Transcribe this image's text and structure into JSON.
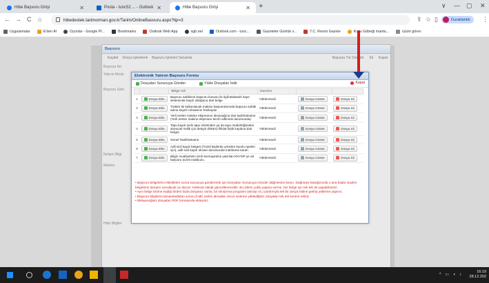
{
  "browser": {
    "tabs": [
      {
        "title": "Hibe Başvuru Girişi",
        "color": "#1a73e8"
      },
      {
        "title": "Posta - tunc52 ... - Outlook",
        "color": "#0a64c2"
      },
      {
        "title": "Hibe Başvuru Girişi",
        "color": "#1a73e8"
      }
    ],
    "new_tab": "+",
    "win_controls": [
      "∨",
      "—",
      "▢",
      "✕"
    ],
    "url": "hibedestek.tarimorman.gov.tr/Tarim/OnlineBasvuru.aspx?tip=3",
    "nav": [
      "←",
      "→",
      "C",
      "⌂"
    ],
    "profile_label": "Duraklatıldı",
    "bookmarks": [
      {
        "label": "Uygulamalar",
        "color": "#5f6368"
      },
      {
        "label": "E'den Al",
        "color": "#e8a317"
      },
      {
        "label": "Oyunlar - Google Pl...",
        "color": "#444"
      },
      {
        "label": "Bookmarks",
        "color": "#333"
      },
      {
        "label": "Outlook Web App",
        "color": "#c0392b"
      },
      {
        "label": "sgb.net",
        "color": "#333"
      },
      {
        "label": "Outlook.com - tunc...",
        "color": "#0a64c2"
      },
      {
        "label": "Gazeteler Günlük v...",
        "color": "#555"
      },
      {
        "label": "T.C. Resmi Gazete",
        "color": "#c0392b"
      },
      {
        "label": "Kuzu Göbeği mantа...",
        "color": "#e8a317"
      },
      {
        "label": "üzüm görev",
        "color": "#8a8a8a"
      }
    ]
  },
  "outer_window": {
    "title": "Başvuru",
    "toolbar_left": [
      "Kaydet",
      "Dosya İşlemleri▾",
      "Başvuru İşlemini Tamamla"
    ],
    "toolbar_right": [
      "Başvuru Tür Değiştir",
      "Sil",
      "Kapat"
    ],
    "side_labels": [
      "Başvuru No",
      "Yatırım Modu",
      "Başvuru Sahi",
      "İletişim Bilgi",
      "Makine",
      "Hibe Bilgiler"
    ]
  },
  "dialog": {
    "title": "Elektronik Yatırım Başvuru Formu",
    "send_button": "Dosyaları Sunucuya Gönder",
    "download_button": "Yükle Dosyaları İndir",
    "close_label": "Kapat",
    "headers": [
      "",
      "",
      "Belge Adı",
      "Durumu",
      "",
      ""
    ],
    "add_label": "Dosya Ekle",
    "view_label": "Dosya Göster",
    "delete_label": "Dosya Sil",
    "rows": [
      {
        "no": "1",
        "name": "Başvuru sahibinin başvuru konusu ile ilgili Bakanlık kayıt sisteminde kaydı olduğuna dair belge",
        "status": "Yüklenmedi"
      },
      {
        "no": "2",
        "name": "Traktör ile kullanılacak makine başvurularında başvuru sahibi adına kayıtlı ruhsatının fotokopisi",
        "status": "Yüklenmedi"
      },
      {
        "no": "3",
        "name": "Yerli üretim makine ekipmanın alınacağına dair taahhütname (Yerli üretim makine ekipmanı tercih edilmesi durumunda)",
        "status": "Yüklenmedi"
      },
      {
        "no": "4",
        "name": "Tapu kaydı (veliı tapu izinleriden ya da tapu müdürlüğünden alınacak malik için detaylı döküm) fiilidat fiştik kaydına dair belge)",
        "status": "Yüklenmedi"
      },
      {
        "no": "5",
        "name": "Genel Taahhütname",
        "status": "Yüklenmedi"
      },
      {
        "no": "6",
        "name": "Adli sicil kaydı belgesi (Tüzel kişilerde yönetim kurulu üyeleri için), adli sicil kaydı olması durumunda mahkeme kararı",
        "status": "Yüklenmedi"
      },
      {
        "no": "7",
        "name": "Bilgiz muafiyetinin izinli sermayesine yatırılan KKYDP ye ait başvuru ücreti makbuzu",
        "status": "Yüklenmedi"
      }
    ],
    "notes": [
      "• Başvuru belgelerini ekledikten sonra sunucuya göndermek için Dosyaları Sunucuya Gönder düğmesine basın. Düğmeye bastığınızda o ana kadar seçilen belgelerin tamamı sunulacak ve durum Yüklendi olarak güncellenecektir. Bu işlemi çoklu yapma verme, her belge için tek tek de yapabilirsiniz.",
      "• Aynı belge türüne eşdiğı birden fazla dosyanız varsa, bir sıkıştırma programı (winzip vs.) yardımıyla tek bir dosya haline getirip yükleme yapınız.",
      "• Başvuru bilgilerini tamamladıktan sonra (3 Mil. teslim almadan önce) sisteme yüklediğiniz dosyaları tek tek kontrol ediniz.",
      "• Ekleyeceğiniz dosyaları PDF formatında ekleyiniz."
    ]
  },
  "taskbar": {
    "time": "16:19",
    "date": "28.12.202"
  }
}
